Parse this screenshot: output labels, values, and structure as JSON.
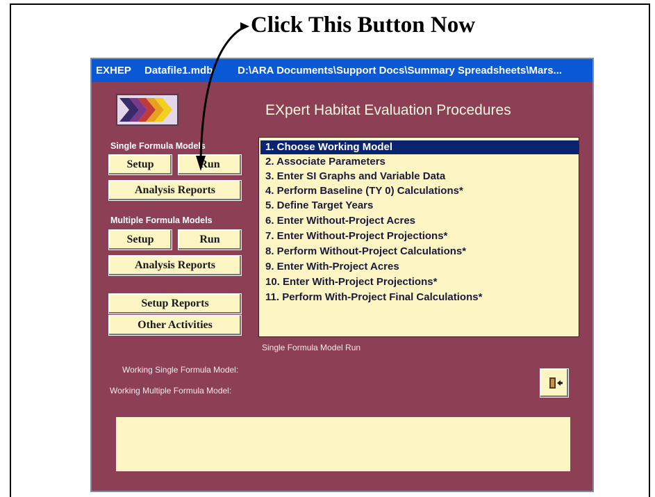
{
  "callout": {
    "text": "Click This Button Now"
  },
  "window": {
    "title_app": "EXHEP",
    "title_file": "Datafile1.mdb",
    "title_path": "D:\\ARA Documents\\Support Docs\\Summary Spreadsheets\\Mars..."
  },
  "header": {
    "title": "EXpert Habitat Evaluation Procedures"
  },
  "single": {
    "label": "Single Formula Models",
    "setup": "Setup",
    "run": "Run",
    "analysis": "Analysis Reports"
  },
  "multiple": {
    "label": "Multiple Formula Models",
    "setup": "Setup",
    "run": "Run",
    "analysis": "Analysis Reports"
  },
  "other_buttons": {
    "setup_reports": "Setup Reports",
    "other_activities": "Other Activities"
  },
  "procedures": [
    "1.  Choose Working Model",
    "2.  Associate Parameters",
    "3.  Enter SI Graphs and Variable Data",
    "4.  Perform Baseline (TY 0) Calculations*",
    "5.  Define Target Years",
    "6.  Enter Without-Project Acres",
    "7.  Enter Without-Project Projections*",
    "8.  Perform Without-Project Calculations*",
    "9.  Enter With-Project Acres",
    "10. Enter With-Project Projections*",
    "11. Perform With-Project Final Calculations*"
  ],
  "status": {
    "mode": "Single Formula Model Run",
    "working_single": "Working Single Formula Model:",
    "working_multiple": "Working Multiple Formula Model:"
  },
  "icons": {
    "logo": "chevrons-logo-icon",
    "exit": "exit-door-icon"
  },
  "colors": {
    "window_bg": "#8c3f55",
    "titlebar": "#0a58d6",
    "button_bg": "#fdf5c4",
    "selection": "#0a2470"
  }
}
